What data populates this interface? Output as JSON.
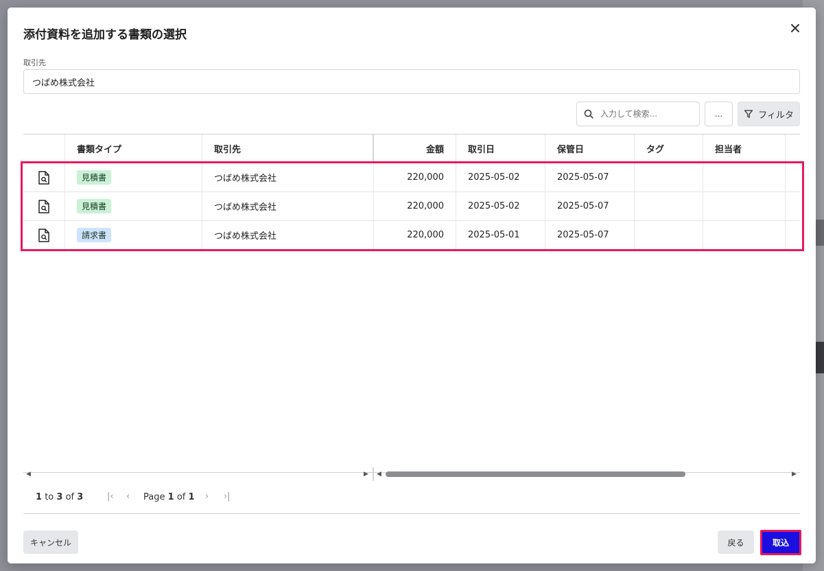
{
  "modal": {
    "title": "添付資料を追加する書類の選択",
    "partner_label": "取引先",
    "partner_value": "つばめ株式会社"
  },
  "toolbar": {
    "search_placeholder": "入力して検索...",
    "more_label": "...",
    "filter_label": "フィルタ"
  },
  "grid": {
    "headers": {
      "doc_type": "書類タイプ",
      "partner": "取引先",
      "amount": "金額",
      "trade_date": "取引日",
      "storage_date": "保管日",
      "tag": "タグ",
      "assignee": "担当者"
    },
    "rows": [
      {
        "doc_type": "見積書",
        "partner": "つばめ株式会社",
        "amount": "220,000",
        "trade_date": "2025-05-02",
        "storage_date": "2025-05-07",
        "tag": "",
        "assignee": ""
      },
      {
        "doc_type": "見積書",
        "partner": "つばめ株式会社",
        "amount": "220,000",
        "trade_date": "2025-05-02",
        "storage_date": "2025-05-07",
        "tag": "",
        "assignee": ""
      },
      {
        "doc_type": "請求書",
        "partner": "つばめ株式会社",
        "amount": "220,000",
        "trade_date": "2025-05-01",
        "storage_date": "2025-05-07",
        "tag": "",
        "assignee": ""
      }
    ],
    "badge_colors": {
      "見積書": "#c9f2d6",
      "請求書": "#cfe2ff"
    }
  },
  "pager": {
    "from": "1",
    "to_word": "to",
    "to": "3",
    "of_word": "of",
    "total": "3",
    "page_word": "Page",
    "page": "1",
    "page_of_word": "of",
    "pages": "1"
  },
  "footer": {
    "cancel_label": "キャンセル",
    "back_label": "戻る",
    "import_label": "取込"
  }
}
